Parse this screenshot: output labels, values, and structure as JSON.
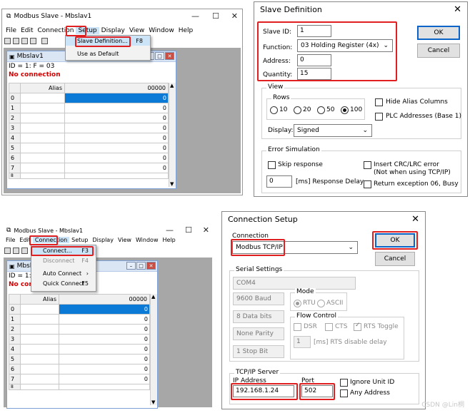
{
  "top_left": {
    "title": "Modbus Slave - Mbslav1",
    "menu": [
      "File",
      "Edit",
      "Connection",
      "Setup",
      "Display",
      "View",
      "Window",
      "Help"
    ],
    "setup_menu": [
      {
        "label": "Slave Definition...",
        "shortcut": "F8"
      },
      {
        "label": "Use as Default",
        "shortcut": ""
      }
    ],
    "child_title": "Mbslav1",
    "id_line": "ID = 1: F = 03",
    "status": "No connection",
    "grid": {
      "alias_header": "Alias",
      "value_header": "00000",
      "rows": [
        "0",
        "1",
        "2",
        "3",
        "4",
        "5",
        "6",
        "7",
        "8"
      ],
      "values": [
        "0",
        "0",
        "0",
        "0",
        "0",
        "0",
        "0",
        "0",
        ""
      ]
    }
  },
  "slave_def": {
    "title": "Slave Definition",
    "slave_id_label": "Slave ID:",
    "slave_id": "1",
    "function_label": "Function:",
    "function": "03 Holding Register (4x)",
    "address_label": "Address:",
    "address": "0",
    "quantity_label": "Quantity:",
    "quantity": "15",
    "ok": "OK",
    "cancel": "Cancel",
    "view_group": "View",
    "rows_group": "Rows",
    "rows_options": [
      "10",
      "20",
      "50",
      "100"
    ],
    "hide_alias": "Hide Alias Columns",
    "plc_addresses": "PLC Addresses (Base 1)",
    "display_label": "Display:",
    "display": "Signed",
    "error_group": "Error Simulation",
    "skip_response": "Skip response",
    "insert_crc": "Insert CRC/LRC error",
    "insert_crc_note": "(Not when using TCP/IP)",
    "delay_value": "0",
    "delay_label": "[ms] Response Delay",
    "return_exception": "Return exception 06, Busy"
  },
  "bottom_left": {
    "title": "Modbus Slave - Mbslav1",
    "menu": [
      "File",
      "Edit",
      "Connection",
      "Setup",
      "Display",
      "View",
      "Window",
      "Help"
    ],
    "connection_menu": [
      {
        "label": "Connect...",
        "shortcut": "F3"
      },
      {
        "label": "Disconnect",
        "shortcut": "F4"
      },
      {
        "label": "Auto Connect",
        "shortcut": "›"
      },
      {
        "label": "Quick Connect",
        "shortcut": "F5"
      }
    ],
    "child_title": "Mbsla",
    "id_line": "ID = 1: F",
    "status": "No conn",
    "grid": {
      "alias_header": "Alias",
      "value_header": "00000",
      "rows": [
        "0",
        "1",
        "2",
        "3",
        "4",
        "5",
        "6",
        "7",
        "8"
      ],
      "values": [
        "0",
        "0",
        "0",
        "0",
        "0",
        "0",
        "0",
        "0",
        ""
      ]
    }
  },
  "conn_setup": {
    "title": "Connection Setup",
    "connection_label": "Connection",
    "connection": "Modbus TCP/IP",
    "ok": "OK",
    "cancel": "Cancel",
    "serial_group": "Serial Settings",
    "port": "COM4",
    "baud": "9600 Baud",
    "mode_group": "Mode",
    "rtu": "RTU",
    "ascii": "ASCII",
    "data_bits": "8 Data bits",
    "flow_group": "Flow Control",
    "dsr": "DSR",
    "cts": "CTS",
    "rts_toggle": "RTS Toggle",
    "parity": "None Parity",
    "stop_bits": "1 Stop Bit",
    "rts_delay_value": "1",
    "rts_delay_label": "[ms] RTS disable delay",
    "tcp_group": "TCP/IP Server",
    "ip_label": "IP Address",
    "ip": "192.168.1.24",
    "port_label": "Port",
    "port_value": "502",
    "ignore_unit": "Ignore Unit ID",
    "any_address": "Any Address"
  },
  "watermark": "CSDN @Lin桐",
  "colors": {
    "highlight": "#e02020",
    "selected_cell": "#0a7ad6",
    "menu_hover": "#cce4f7"
  }
}
